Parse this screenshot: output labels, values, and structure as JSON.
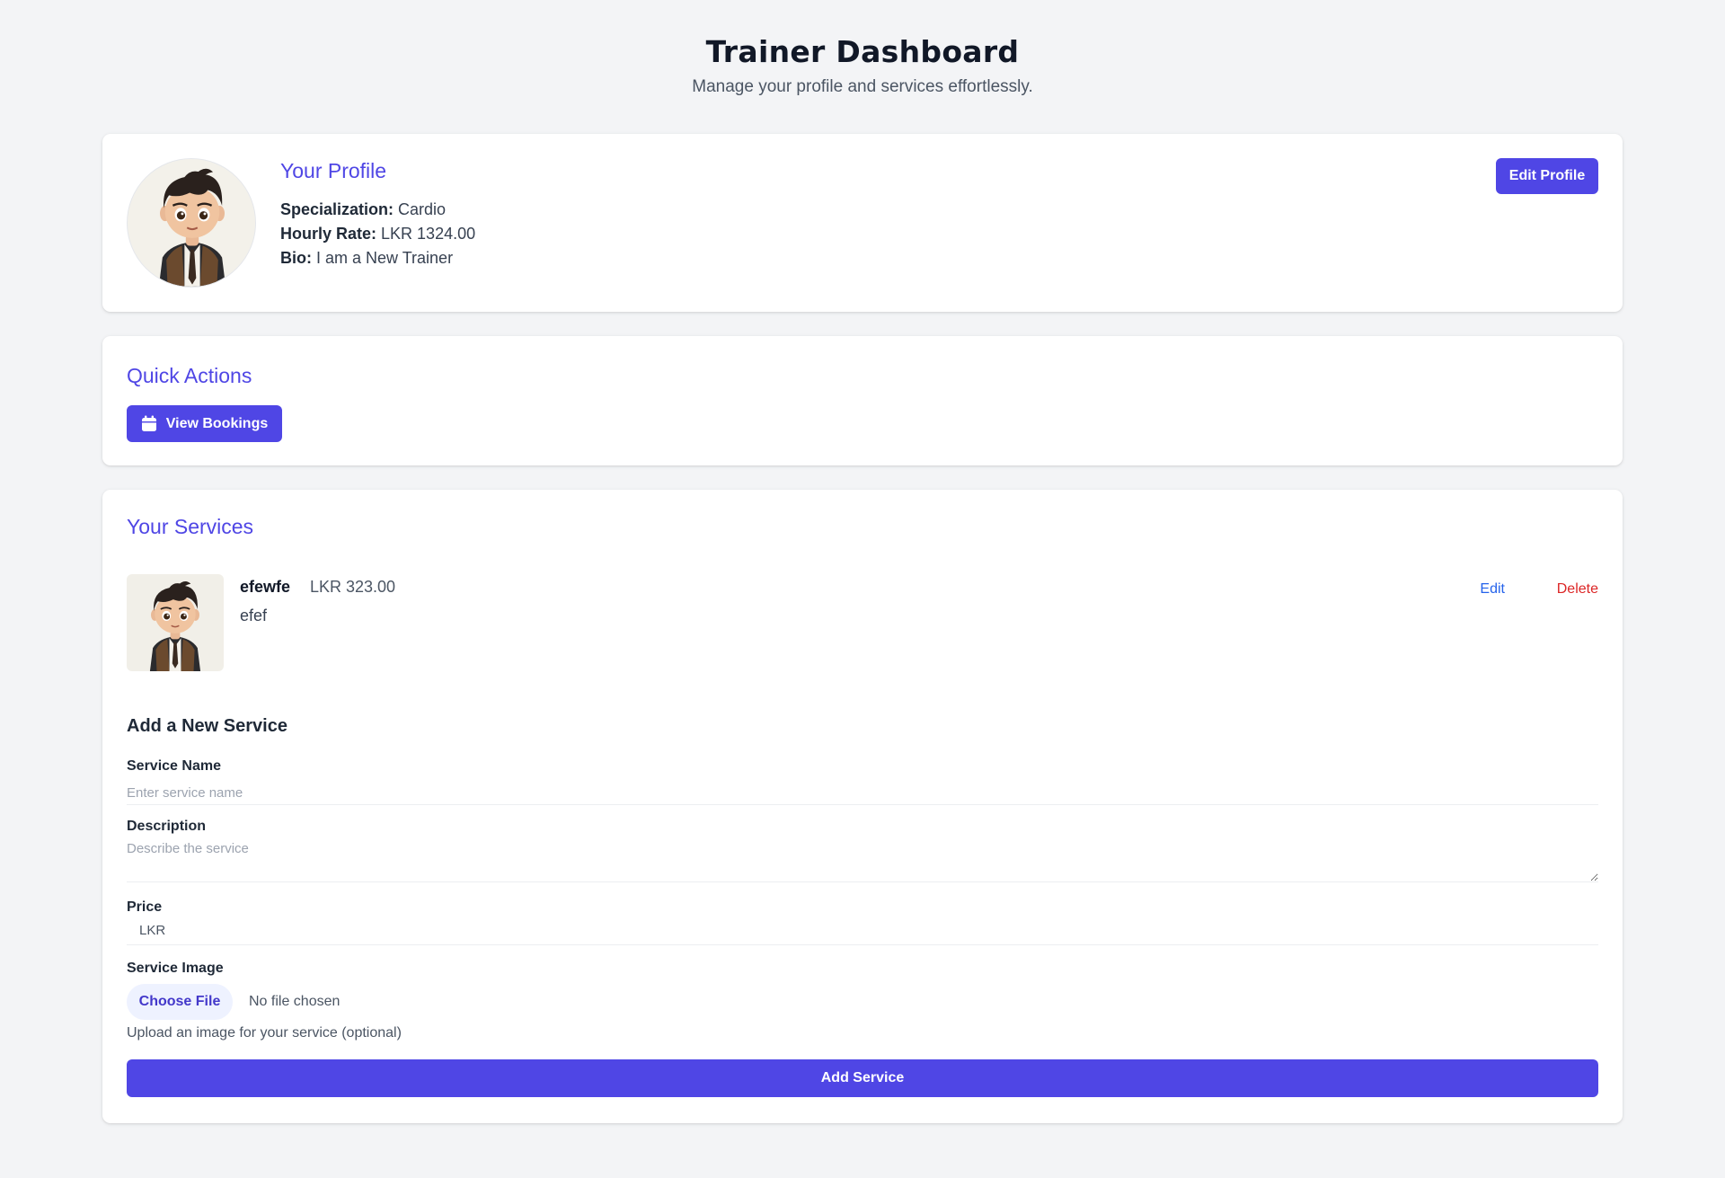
{
  "header": {
    "title": "Trainer Dashboard",
    "subtitle": "Manage your profile and services effortlessly."
  },
  "profile": {
    "section_title": "Your Profile",
    "avatar_icon": "cartoon-trainer-avatar",
    "fields": [
      {
        "key": "Specialization:",
        "value": "Cardio"
      },
      {
        "key": "Hourly Rate:",
        "value": "LKR 1324.00"
      },
      {
        "key": "Bio:",
        "value": "I am a New Trainer"
      }
    ],
    "edit_button": "Edit Profile"
  },
  "quick_actions": {
    "section_title": "Quick Actions",
    "view_bookings_icon": "calendar-icon",
    "view_bookings_label": "View Bookings"
  },
  "services": {
    "section_title": "Your Services",
    "items": [
      {
        "name": "efewfe",
        "price": "LKR 323.00",
        "description": "efef",
        "edit_label": "Edit",
        "delete_label": "Delete"
      }
    ]
  },
  "add_service_form": {
    "title": "Add a New Service",
    "name_label": "Service Name",
    "name_placeholder": "Enter service name",
    "description_label": "Description",
    "description_placeholder": "Describe the service",
    "price_label": "Price",
    "price_prefix": "LKR",
    "image_label": "Service Image",
    "choose_file_label": "Choose File",
    "file_status": "No file chosen",
    "image_hint": "Upload an image for your service (optional)",
    "submit_label": "Add Service"
  },
  "colors": {
    "accent": "#4f46e5",
    "background": "#f3f4f6",
    "edit_link": "#2563eb",
    "delete_link": "#dc2626"
  }
}
